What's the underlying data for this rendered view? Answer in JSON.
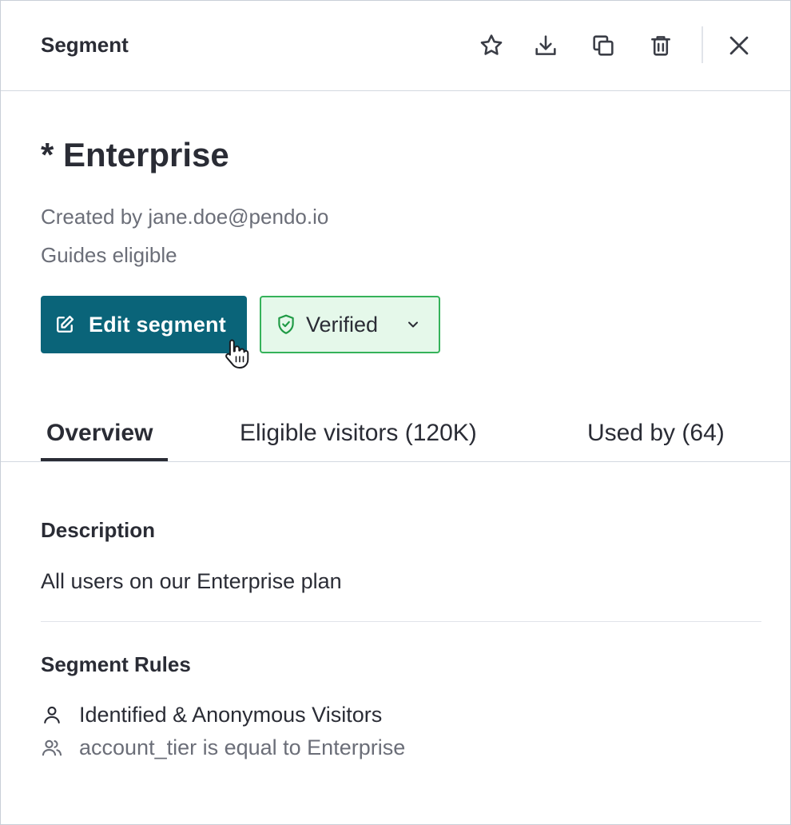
{
  "header": {
    "title": "Segment",
    "actions": [
      {
        "name": "favorite",
        "icon": "star-icon"
      },
      {
        "name": "download",
        "icon": "download-icon"
      },
      {
        "name": "duplicate",
        "icon": "copy-icon"
      },
      {
        "name": "delete",
        "icon": "trash-icon"
      },
      {
        "name": "close",
        "icon": "close-icon"
      }
    ]
  },
  "segment": {
    "title": "* Enterprise",
    "created_by": "Created by jane.doe@pendo.io",
    "eligibility": "Guides eligible",
    "edit_label": "Edit segment",
    "status_label": "Verified"
  },
  "tabs": [
    {
      "label": "Overview",
      "active": true
    },
    {
      "label": "Eligible visitors (120K)",
      "active": false
    },
    {
      "label": "Used by (64)",
      "active": false
    }
  ],
  "overview": {
    "description_title": "Description",
    "description_text": "All users on our Enterprise plan",
    "rules_title": "Segment Rules",
    "rules": [
      {
        "icon": "user-icon",
        "text": "Identified & Anonymous Visitors"
      },
      {
        "icon": "users-icon",
        "text": "account_tier is equal to Enterprise"
      }
    ]
  },
  "colors": {
    "primary": "#0a6479",
    "verified_bg": "#e5f8ea",
    "verified_border": "#35b25a",
    "verified_icon": "#1f9a45",
    "text": "#2a2c35",
    "muted": "#6b6e78"
  }
}
